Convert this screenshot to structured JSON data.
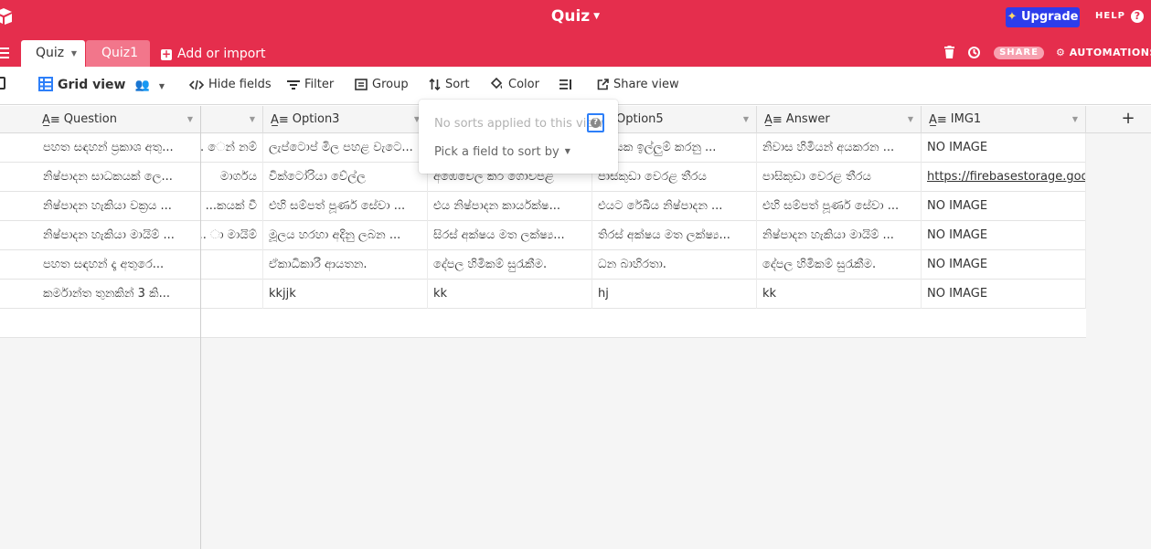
{
  "header": {
    "title": "Quiz",
    "upgrade_label": "Upgrade",
    "help_label": "HELP",
    "share_label": "SHARE",
    "automations_label": "AUTOMATIONS",
    "brand_color": "#e52e4d",
    "upgrade_color": "#2d3deb"
  },
  "tabs": [
    {
      "label": "Quiz",
      "active": true
    },
    {
      "label": "Quiz1",
      "active": false
    }
  ],
  "add_import_label": "Add or import",
  "toolbar": {
    "view_name": "Grid view",
    "hide_fields": "Hide fields",
    "filter": "Filter",
    "group": "Group",
    "sort": "Sort",
    "color": "Color",
    "share_view": "Share view"
  },
  "columns": {
    "question": "Question",
    "option3": "Option3",
    "option5": "Option5",
    "answer": "Answer",
    "img1": "IMG1"
  },
  "rows": [
    {
      "question": "පහත සඳහන් ප්‍රකාශ අතු...",
      "opt2": "ෙන් නම් ...",
      "opt3": "ලැප්ටොප් මිල පහළ වැටෙ...",
      "opt4": "",
      "opt5": "ෂ්ඩයක ඉල්ලුම් කරනු ...",
      "answer": "නිවාස හිමියන් අයකරන ...",
      "img1": "NO IMAGE",
      "img_link": false
    },
    {
      "question": "නිෂ්පාදන සාධකයක් ලෙ...",
      "opt2": "මාර්ගය",
      "opt3": "වික්ටෝරියා වේල්ල",
      "opt4": "අඹෙවෙල කිරි ගොවිපළ",
      "opt5": "පාසිකුඩා වෙරළ තීරය",
      "answer": "පාසිකුඩා වෙරළ තීරය",
      "img1": "https://firebasestorage.goo...",
      "img_link": true
    },
    {
      "question": "නිෂ්පාදන හැකියා වක්‍රය ...",
      "opt2": "කයක් වී...",
      "opt3": "එහි සම්පත් පූර්ණ සේවා ...",
      "opt4": "එය නිෂ්පාදන කාර්යක්ෂ...",
      "opt5": "එයට රේඛීය නිෂ්පාදන ...",
      "answer": "එහි සම්පත් පූර්ණ සේවා ...",
      "img1": "NO IMAGE",
      "img_link": false
    },
    {
      "question": "නිෂ්පාදන හැකියා මායිම් ...",
      "opt2": "ා මායිම් ...",
      "opt3": "මූලය හරහා අදිනු ලබන ...",
      "opt4": "සිරස් අක්ෂය මත ලක්ෂ්‍ය...",
      "opt5": "තිරස් අක්ෂය මත ලක්ෂ්‍ය...",
      "answer": "නිෂ්පාදන හැකියා මායිම් ...",
      "img1": "NO IMAGE",
      "img_link": false
    },
    {
      "question": "පහත සඳහන් දෑ අතුරෙ...",
      "opt2": "",
      "opt3": "ඒකාධිකාරී ආයතන.",
      "opt4": "දේපල හිමිකම් සුරැකීම.",
      "opt5": "ධන බාහිරතා.",
      "answer": "දේපල හිමිකම් සුරැකීම.",
      "img1": "NO IMAGE",
      "img_link": false
    },
    {
      "question": "කර්මාන්ත තුනකින් 3 කි...",
      "opt2": "",
      "opt3": "kkjjk",
      "opt4": "kk",
      "opt5": "hj",
      "answer": "kk",
      "img1": "NO IMAGE",
      "img_link": false
    }
  ],
  "sort_popover": {
    "notice": "No sorts applied to this view",
    "pick_label": "Pick a field to sort by"
  }
}
